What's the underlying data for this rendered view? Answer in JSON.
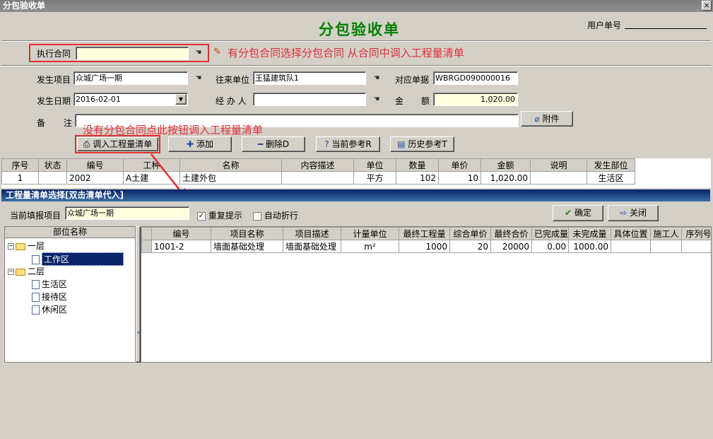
{
  "window": {
    "title": "分包验收单",
    "close": "×"
  },
  "form": {
    "heading": "分包验收单",
    "user_no_label": "用户单号",
    "contract_label": "执行合同",
    "contract_value": "",
    "project_label": "发生项目",
    "project_value": "众城广场一期",
    "partner_label": "往来单位",
    "partner_value": "王猛建筑队1",
    "ref_label": "对应单据",
    "ref_value": "WBRGD090000016",
    "date_label": "发生日期",
    "date_value": "2016-02-01",
    "handler_label": "经 办 人",
    "handler_value": "",
    "amount_label_1": "金",
    "amount_label_2": "额",
    "amount_value": "1,020.00",
    "note_label_1": "备",
    "note_label_2": "注",
    "note_value": ""
  },
  "annotations": {
    "contract_hint": "有分包合同选择分包合同 从合同中调入工程量清单",
    "import_hint": "没有分包合同点此按钮调入工程量清单"
  },
  "toolbar": {
    "attach": "附件",
    "import": "调入工程量清单",
    "add": "添加",
    "delete": "删除D",
    "current_ref": "当前参考R",
    "history_ref": "历史参考T"
  },
  "main_table": {
    "headers": [
      "序号",
      "状态",
      "编号",
      "工种",
      "名称",
      "内容描述",
      "单位",
      "数量",
      "单价",
      "金额",
      "说明",
      "发生部位"
    ],
    "rows": [
      [
        "1",
        "",
        "2002",
        "A土建",
        "土建外包",
        "",
        "平方",
        "102",
        "10",
        "1,020.00",
        "",
        "生活区"
      ]
    ]
  },
  "panel": {
    "title": "工程量清单选择[双击清单代入]",
    "project_label": "当前填报项目",
    "project_value": "众城广场一期",
    "repeat_label": "重复提示",
    "repeat_checked": true,
    "wrap_label": "自动折行",
    "wrap_checked": false,
    "confirm": "确定",
    "close": "关闭",
    "tree_header": "部位名称",
    "tree": [
      {
        "label": "一层",
        "children": [
          "工作区"
        ]
      },
      {
        "label": "二层",
        "children": [
          "生活区",
          "接待区",
          "休闲区"
        ]
      }
    ],
    "list_headers": [
      "编号",
      "项目名称",
      "项目描述",
      "计量单位",
      "最终工程量",
      "综合单价",
      "最终合价",
      "已完成量",
      "未完成量",
      "具体位置",
      "施工人",
      "序列号"
    ],
    "list_rows": [
      [
        "1001-2",
        "墙面基础处理",
        "墙面基础处理",
        "m²",
        "1000",
        "20",
        "20000",
        "0.00",
        "1000.00",
        "",
        "",
        ""
      ]
    ]
  }
}
